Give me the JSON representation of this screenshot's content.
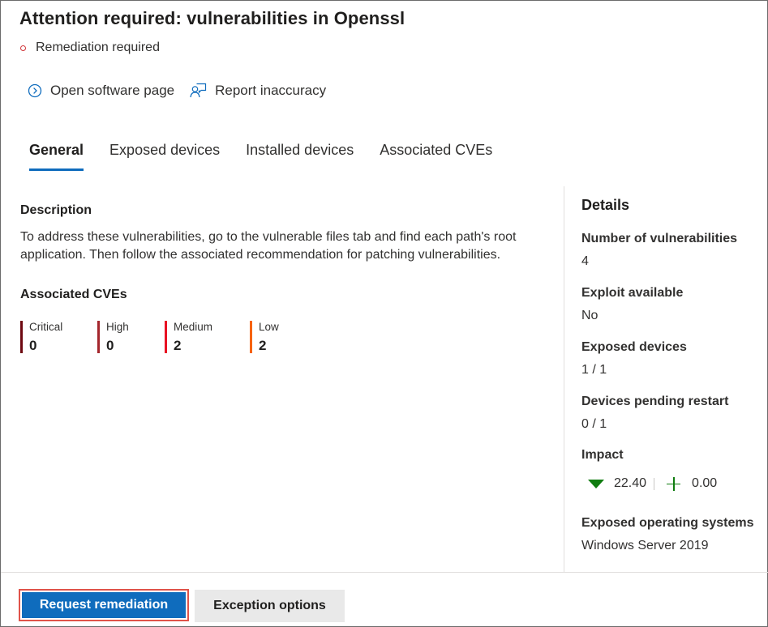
{
  "panel": {
    "title": "Attention required: vulnerabilities in Openssl",
    "status": "Remediation required"
  },
  "actions": {
    "open_software": "Open software page",
    "report_inaccuracy": "Report inaccuracy"
  },
  "tabs": [
    {
      "label": "General",
      "active": true
    },
    {
      "label": "Exposed devices",
      "active": false
    },
    {
      "label": "Installed devices",
      "active": false
    },
    {
      "label": "Associated CVEs",
      "active": false
    }
  ],
  "general": {
    "description_heading": "Description",
    "description_text": "To address these vulnerabilities, go to the vulnerable files tab and find each path's root application. Then follow the associated recommendation for patching vulnerabilities.",
    "cves_heading": "Associated CVEs",
    "severities": [
      {
        "name": "Critical",
        "count": "0",
        "color": "#6e0811"
      },
      {
        "name": "High",
        "count": "0",
        "color": "#a4262c"
      },
      {
        "name": "Medium",
        "count": "2",
        "color": "#e81123"
      },
      {
        "name": "Low",
        "count": "2",
        "color": "#f7630c"
      }
    ]
  },
  "details": {
    "heading": "Details",
    "items": [
      {
        "label": "Number of vulnerabilities",
        "value": "4"
      },
      {
        "label": "Exploit available",
        "value": "No"
      },
      {
        "label": "Exposed devices",
        "value": "1 / 1"
      },
      {
        "label": "Devices pending restart",
        "value": "0 / 1"
      },
      {
        "label": "Impact",
        "value": ""
      },
      {
        "label": "Exposed operating systems",
        "value": "Windows Server 2019"
      }
    ],
    "impact": {
      "exposure_score": "22.40",
      "secure_score": "0.00"
    }
  },
  "footer": {
    "primary_button": "Request remediation",
    "secondary_button": "Exception options"
  },
  "colors": {
    "accent": "#0f6cbd",
    "status_dot": "#d13438",
    "impact_green": "#107c10"
  }
}
